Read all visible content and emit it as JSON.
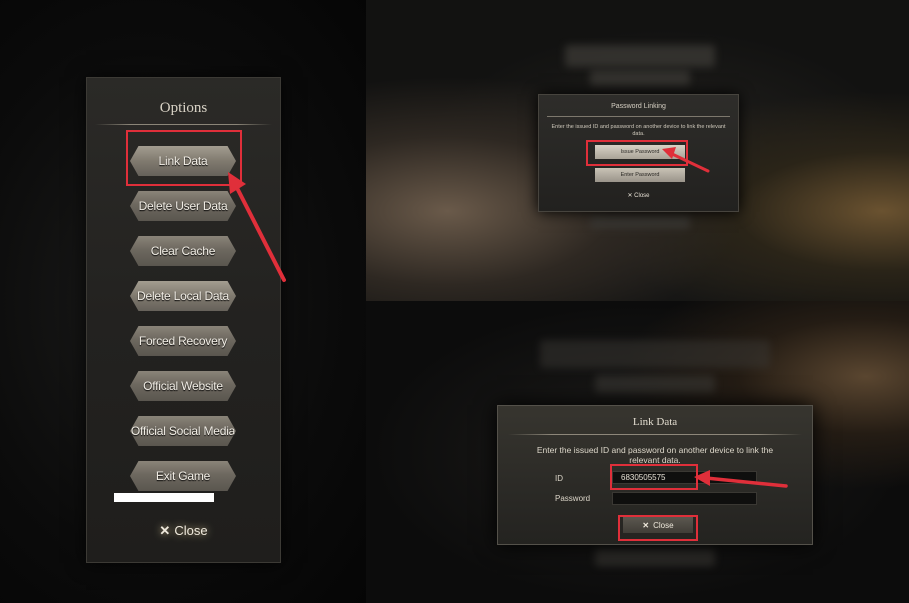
{
  "options": {
    "title": "Options",
    "buttons": [
      {
        "label": "Link Data"
      },
      {
        "label": "Delete User Data"
      },
      {
        "label": "Clear Cache"
      },
      {
        "label": "Delete Local Data"
      },
      {
        "label": "Forced Recovery"
      },
      {
        "label": "Official Website"
      },
      {
        "label": "Official Social Media"
      },
      {
        "label": "Exit Game"
      }
    ],
    "close_icon": "x-icon",
    "close_label": "Close"
  },
  "password_linking": {
    "title": "Password Linking",
    "description": "Enter the issued ID and password on another device to link the relevant data.",
    "issue_button": "Issue Password",
    "enter_button": "Enter Password",
    "close_label": "Close"
  },
  "link_data": {
    "title": "Link Data",
    "description": "Enter the issued ID and password on another device to link the relevant data.",
    "id_label": "ID",
    "id_value": "6830505575",
    "password_label": "Password",
    "close_label": "Close"
  },
  "colors": {
    "highlight": "#e02f3a"
  }
}
